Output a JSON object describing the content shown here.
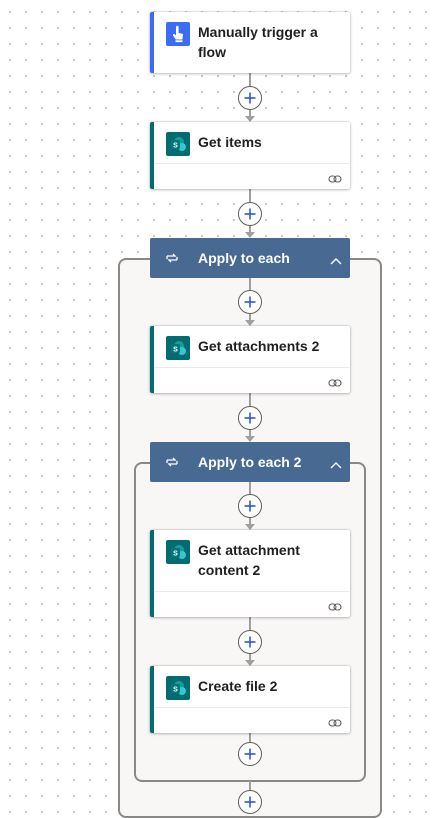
{
  "flow": {
    "trigger": {
      "title": "Manually trigger a flow",
      "accent": "#3a6cf4",
      "icon": "hand-pointer-icon",
      "icon_bg": "#3a6cf4"
    },
    "get_items": {
      "title": "Get items",
      "accent": "#036c70",
      "icon": "sharepoint-icon",
      "icon_bg": "#036c70"
    },
    "apply_each_1": {
      "title": "Apply to each",
      "header_color": "#486991",
      "icon": "loop-icon"
    },
    "get_attachments": {
      "title": "Get attachments 2",
      "accent": "#036c70",
      "icon": "sharepoint-icon"
    },
    "apply_each_2": {
      "title": "Apply to each 2",
      "header_color": "#486991",
      "icon": "loop-icon"
    },
    "get_attachment_content": {
      "title": "Get attachment content 2",
      "accent": "#036c70",
      "icon": "sharepoint-icon"
    },
    "create_file": {
      "title": "Create file 2",
      "accent": "#036c70",
      "icon": "sharepoint-icon"
    }
  },
  "colors": {
    "connector": "#a19f9d",
    "scope_border": "#8a8886",
    "scope_bg": "#f8f7f6",
    "canvas_dot": "#c8c6c4"
  }
}
